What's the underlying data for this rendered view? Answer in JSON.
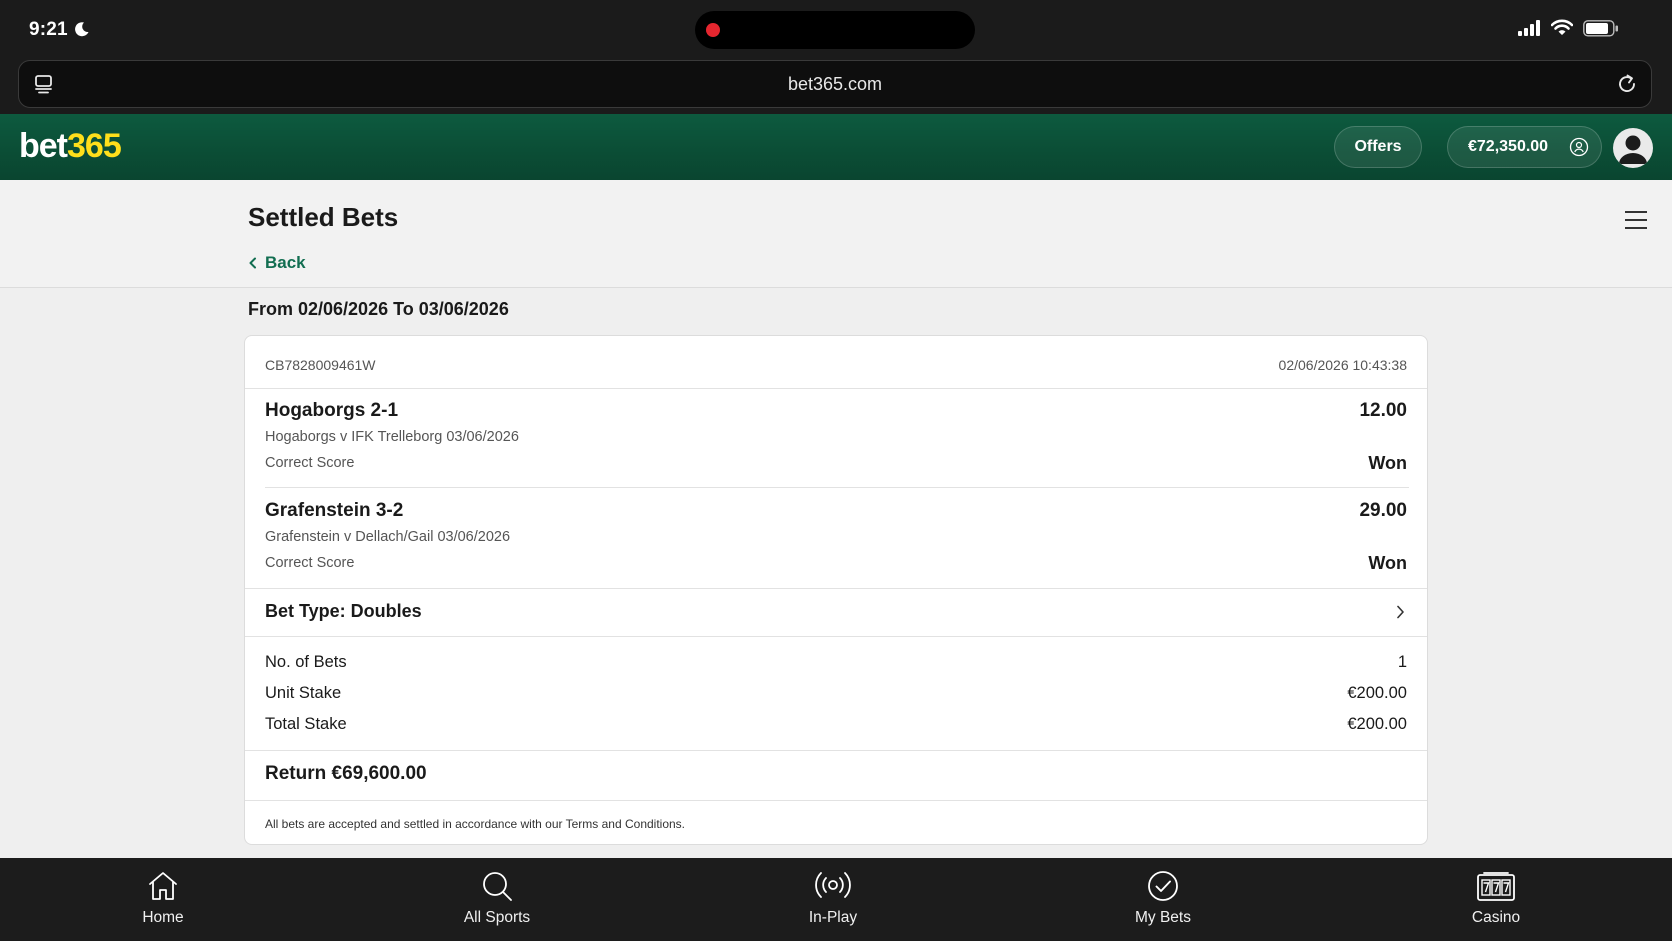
{
  "status_bar": {
    "time": "9:21"
  },
  "browser": {
    "url": "bet365.com"
  },
  "header": {
    "logo_white": "bet",
    "logo_yellow": "365",
    "offers_label": "Offers",
    "balance": "€72,350.00"
  },
  "page": {
    "title": "Settled Bets",
    "back_label": "Back",
    "date_range": "From 02/06/2026 To 03/06/2026"
  },
  "bet": {
    "reference": "CB7828009461W",
    "timestamp": "02/06/2026 10:43:38",
    "selections": [
      {
        "title": "Hogaborgs 2-1",
        "odds": "12.00",
        "fixture": "Hogaborgs v IFK Trelleborg 03/06/2026",
        "market": "Correct Score",
        "result": "Won"
      },
      {
        "title": "Grafenstein 3-2",
        "odds": "29.00",
        "fixture": "Grafenstein v Dellach/Gail 03/06/2026",
        "market": "Correct Score",
        "result": "Won"
      }
    ],
    "bet_type": "Bet Type: Doubles",
    "details": [
      {
        "label": "No. of Bets",
        "value": "1"
      },
      {
        "label": "Unit Stake",
        "value": "€200.00"
      },
      {
        "label": "Total Stake",
        "value": "€200.00"
      }
    ],
    "return": "Return €69,600.00",
    "terms": "All bets are accepted and settled in accordance with our Terms and Conditions."
  },
  "bottom_nav": [
    {
      "label": "Home",
      "icon": "home-icon"
    },
    {
      "label": "All Sports",
      "icon": "search-icon"
    },
    {
      "label": "In-Play",
      "icon": "live-broadcast-icon"
    },
    {
      "label": "My Bets",
      "icon": "checkmark-circle-icon"
    },
    {
      "label": "Casino",
      "icon": "slot-machine-icon"
    }
  ],
  "colors": {
    "brand_green": "#0b4d35",
    "logo_yellow": "#ffdf1b",
    "link_green": "#126e51"
  }
}
